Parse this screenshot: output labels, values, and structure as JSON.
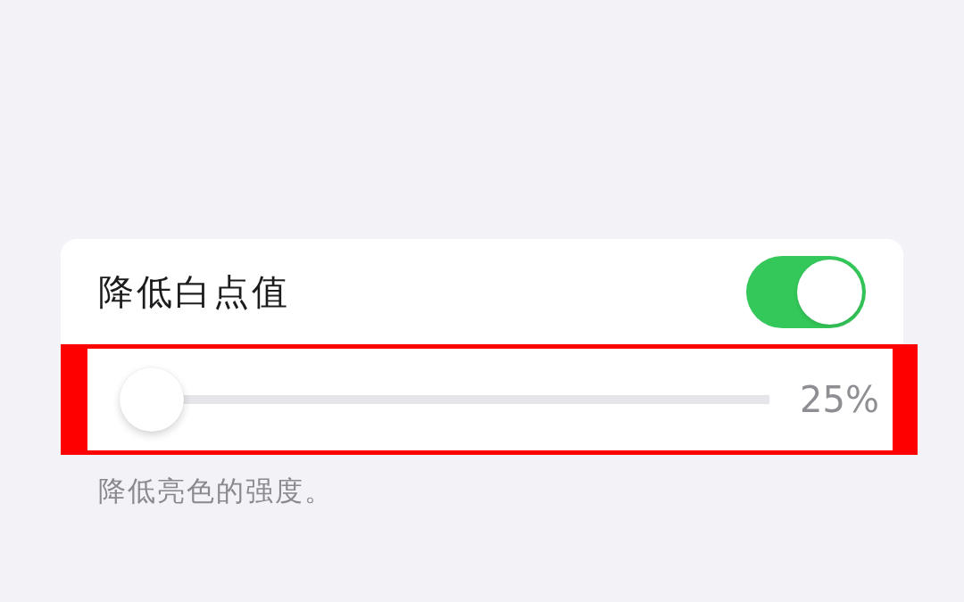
{
  "setting": {
    "label": "降低白点值",
    "on": true
  },
  "slider": {
    "level": 0,
    "value": "25%"
  },
  "footer": "降低亮色的强度。"
}
